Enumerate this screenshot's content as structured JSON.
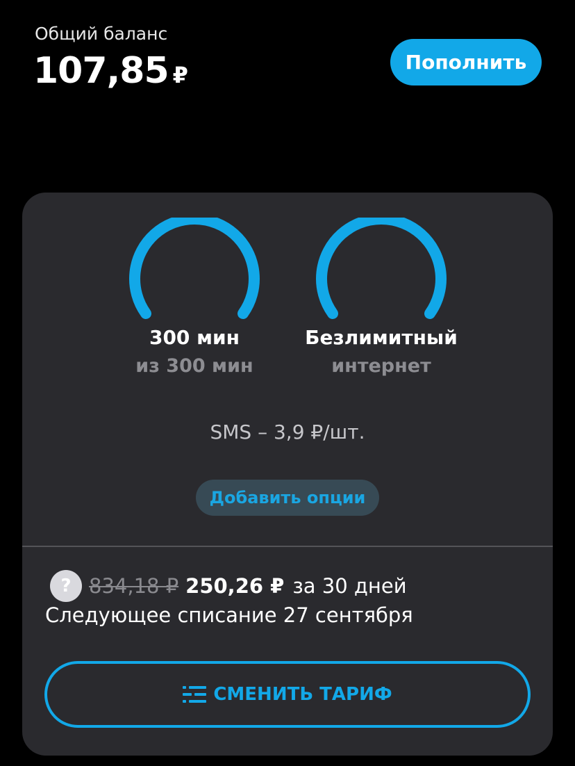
{
  "header": {
    "balance_label": "Общий баланс",
    "balance_value": "107,85",
    "currency": "₽",
    "topup_label": "Пополнить"
  },
  "gauges": [
    {
      "title": "300 мин",
      "subtitle": "из 300 мин",
      "remaining_fraction": 1.0
    },
    {
      "title": "Безлимитный",
      "subtitle": "интернет",
      "remaining_fraction": 1.0
    }
  ],
  "sms_note": "SMS – 3,9 ₽/шт.",
  "add_options_label": "Добавить опции",
  "billing": {
    "help_icon_text": "?",
    "old_price": "834,18 ₽",
    "new_price": "250,26 ₽",
    "period": "за 30 дней",
    "next_charge": "Следующее списание 27 сентября"
  },
  "change_plan_label": "СМЕНИТЬ ТАРИФ",
  "colors": {
    "accent": "#12a8e8",
    "card_background": "#2a2a2e",
    "page_background": "#000000"
  },
  "icons": {
    "change_plan": "sliders-list-icon",
    "help": "question-icon"
  }
}
